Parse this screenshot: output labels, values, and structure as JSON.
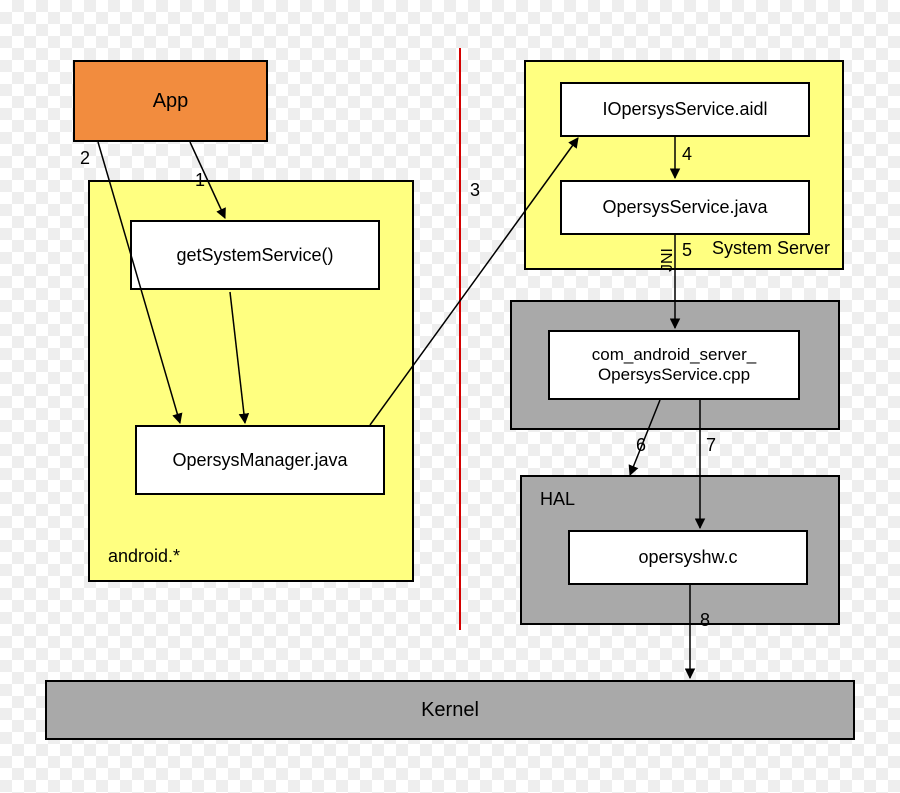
{
  "nodes": {
    "app": "App",
    "getSystemService": "getSystemService()",
    "opersysManager": "OpersysManager.java",
    "iopersysAidl": "IOpersysService.aidl",
    "opersysServiceJava": "OpersysService.java",
    "jniCpp_line1": "com_android_server_",
    "jniCpp_line2": "OpersysService.cpp",
    "halC": "opersyshw.c",
    "kernel": "Kernel"
  },
  "groups": {
    "androidStar": "android.*",
    "systemServer": "System Server",
    "hal": "HAL"
  },
  "labels": {
    "jni_vertical": "JNI"
  },
  "edges": {
    "e1": "1",
    "e2": "2",
    "e3": "3",
    "e4": "4",
    "e5": "5",
    "e6": "6",
    "e7": "7",
    "e8": "8"
  },
  "chart_data": {
    "type": "flow-diagram",
    "title": "Android System Service call chain",
    "nodes": [
      {
        "id": "app",
        "label": "App",
        "group": null,
        "fill": "orange"
      },
      {
        "id": "getSys",
        "label": "getSystemService()",
        "group": "android.*",
        "fill": "white"
      },
      {
        "id": "mgr",
        "label": "OpersysManager.java",
        "group": "android.*",
        "fill": "white"
      },
      {
        "id": "aidl",
        "label": "IOpersysService.aidl",
        "group": "System Server",
        "fill": "white"
      },
      {
        "id": "svc",
        "label": "OpersysService.java",
        "group": "System Server",
        "fill": "white"
      },
      {
        "id": "jni",
        "label": "com_android_server_OpersysService.cpp",
        "group": "JNI-group",
        "fill": "white"
      },
      {
        "id": "halc",
        "label": "opersyshw.c",
        "group": "HAL",
        "fill": "white"
      },
      {
        "id": "kernel",
        "label": "Kernel",
        "group": null,
        "fill": "gray"
      }
    ],
    "groups": [
      {
        "id": "android.*",
        "fill": "yellow"
      },
      {
        "id": "System Server",
        "fill": "yellow"
      },
      {
        "id": "JNI-group",
        "fill": "gray"
      },
      {
        "id": "HAL",
        "fill": "gray"
      }
    ],
    "edges": [
      {
        "n": 1,
        "from": "app",
        "to": "getSys"
      },
      {
        "n": 2,
        "from": "app",
        "to": "mgr"
      },
      {
        "n": 3,
        "from": "mgr",
        "to": "aidl"
      },
      {
        "n": 4,
        "from": "aidl",
        "to": "svc"
      },
      {
        "n": 5,
        "from": "svc",
        "to": "jni",
        "label": "JNI"
      },
      {
        "n": 6,
        "from": "jni",
        "to": "halc"
      },
      {
        "n": 7,
        "from": "jni",
        "to": "halc"
      },
      {
        "n": 8,
        "from": "halc",
        "to": "kernel"
      }
    ],
    "divider": "vertical red line separating android.* side from System Server side"
  }
}
